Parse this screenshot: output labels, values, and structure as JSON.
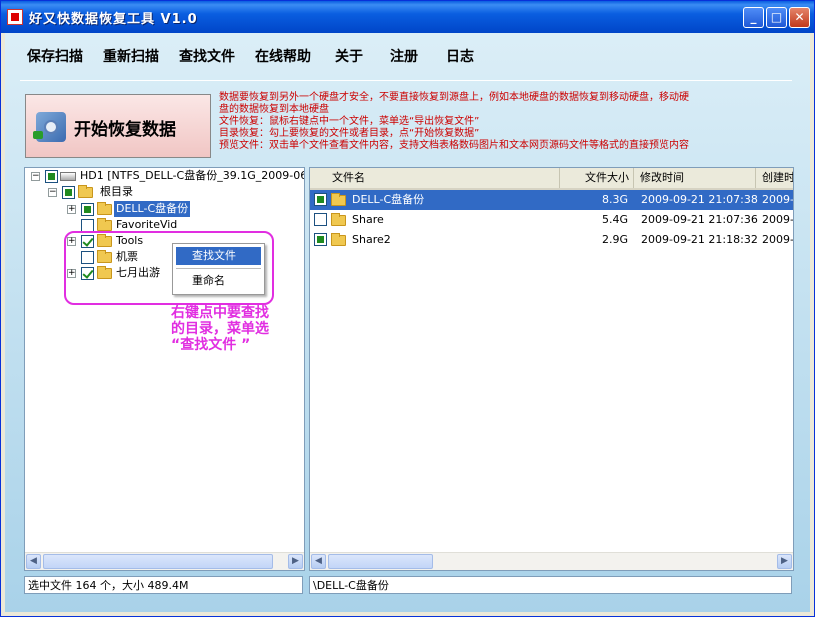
{
  "window": {
    "title": "好又快数据恢复工具 V1.0",
    "controls": {
      "minimize": "_",
      "maximize": "□",
      "close": "✕"
    }
  },
  "menu": [
    "保存扫描",
    "重新扫描",
    "查找文件",
    "在线帮助",
    "关于",
    "注册",
    "日志"
  ],
  "start_button": {
    "label": "开始恢复数据",
    "icon": "disk-recovery-icon"
  },
  "info_lines": [
    "数据要恢复到另外一个硬盘才安全，不要直接恢复到源盘上，例如本地硬盘的数据恢复到移动硬盘，移动硬",
    "盘的数据恢复到本地硬盘",
    "文件恢复：鼠标右键点中一个文件，菜单选“导出恢复文件”",
    "目录恢复：勾上要恢复的文件或者目录，点“开始恢复数据”",
    "预览文件：双击单个文件查看文件内容，支持文档表格数码图片和文本网页源码文件等格式的直接预览内容"
  ],
  "tree": {
    "drive": "HD1  [NTFS_DELL-C盘备份_39.1G_2009-06-1",
    "root": "根目录",
    "items": [
      {
        "label": "DELL-C盘备份",
        "state": "partial",
        "expandable": true,
        "selected": true
      },
      {
        "label": "FavoriteVid",
        "state": "unchecked",
        "expandable": false,
        "selected": false
      },
      {
        "label": "Tools",
        "state": "checked",
        "expandable": true,
        "selected": false
      },
      {
        "label": "机票",
        "state": "unchecked",
        "expandable": false,
        "selected": false
      },
      {
        "label": "七月出游",
        "state": "checked",
        "expandable": true,
        "selected": false
      }
    ]
  },
  "context_menu": {
    "items": [
      "查找文件",
      "重命名"
    ],
    "highlighted": "查找文件"
  },
  "annotation": [
    "右键点中要查找",
    "的目录，菜单选",
    "“查找文件 ”"
  ],
  "list": {
    "columns": [
      "文件名",
      "文件大小",
      "修改时间",
      "创建时"
    ],
    "rows": [
      {
        "name": "DELL-C盘备份",
        "size": "8.3G",
        "modified": "2009-09-21 21:07:38",
        "created": "2009-0",
        "state": "partial",
        "selected": true
      },
      {
        "name": "Share",
        "size": "5.4G",
        "modified": "2009-09-21 21:07:36",
        "created": "2009-0",
        "state": "unchecked",
        "selected": false
      },
      {
        "name": "Share2",
        "size": "2.9G",
        "modified": "2009-09-21 21:18:32",
        "created": "2009-0",
        "state": "partial",
        "selected": false
      }
    ]
  },
  "status": {
    "left": "选中文件 164 个，大小 489.4M",
    "right": "\\DELL-C盘备份"
  },
  "colors": {
    "accent": "#316ac5",
    "annotation": "#e12ee1",
    "info_text": "#cc0000",
    "title_bar": "#0a5ee0"
  }
}
